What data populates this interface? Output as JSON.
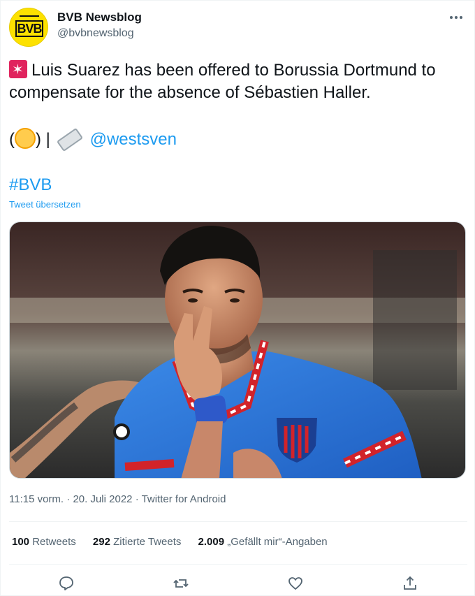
{
  "author": {
    "name": "BVB Newsblog",
    "handle": "@bvbnewsblog",
    "avatar_text": "BVB"
  },
  "tweet": {
    "text": "Luis Suarez has been offered to Borussia Dortmund to compensate for the absence of Sébastien Haller.",
    "source_open": "(",
    "source_close": ") |",
    "mention": "@westsven",
    "hashtag": "#BVB",
    "translate_link": "Tweet übersetzen"
  },
  "meta": {
    "time": "11:15 vorm.",
    "sep": "·",
    "date": "20. Juli 2022",
    "client": "Twitter for Android",
    "line": "11:15 vorm. · 20. Juli 2022 · Twitter for Android"
  },
  "stats": {
    "retweets_count": "100",
    "retweets_label": "Retweets",
    "quotes_count": "292",
    "quotes_label": "Zitierte Tweets",
    "likes_count": "2.009",
    "likes_label": "„Gefällt mir“-Angaben"
  },
  "icons": {
    "more": "more-icon",
    "reply": "reply-icon",
    "retweet": "retweet-icon",
    "like": "like-icon",
    "share": "share-icon"
  },
  "colors": {
    "link": "#1d9bf0",
    "secondary": "#536471",
    "jersey": "#2a72d6",
    "avatar_bg": "#fde100"
  }
}
